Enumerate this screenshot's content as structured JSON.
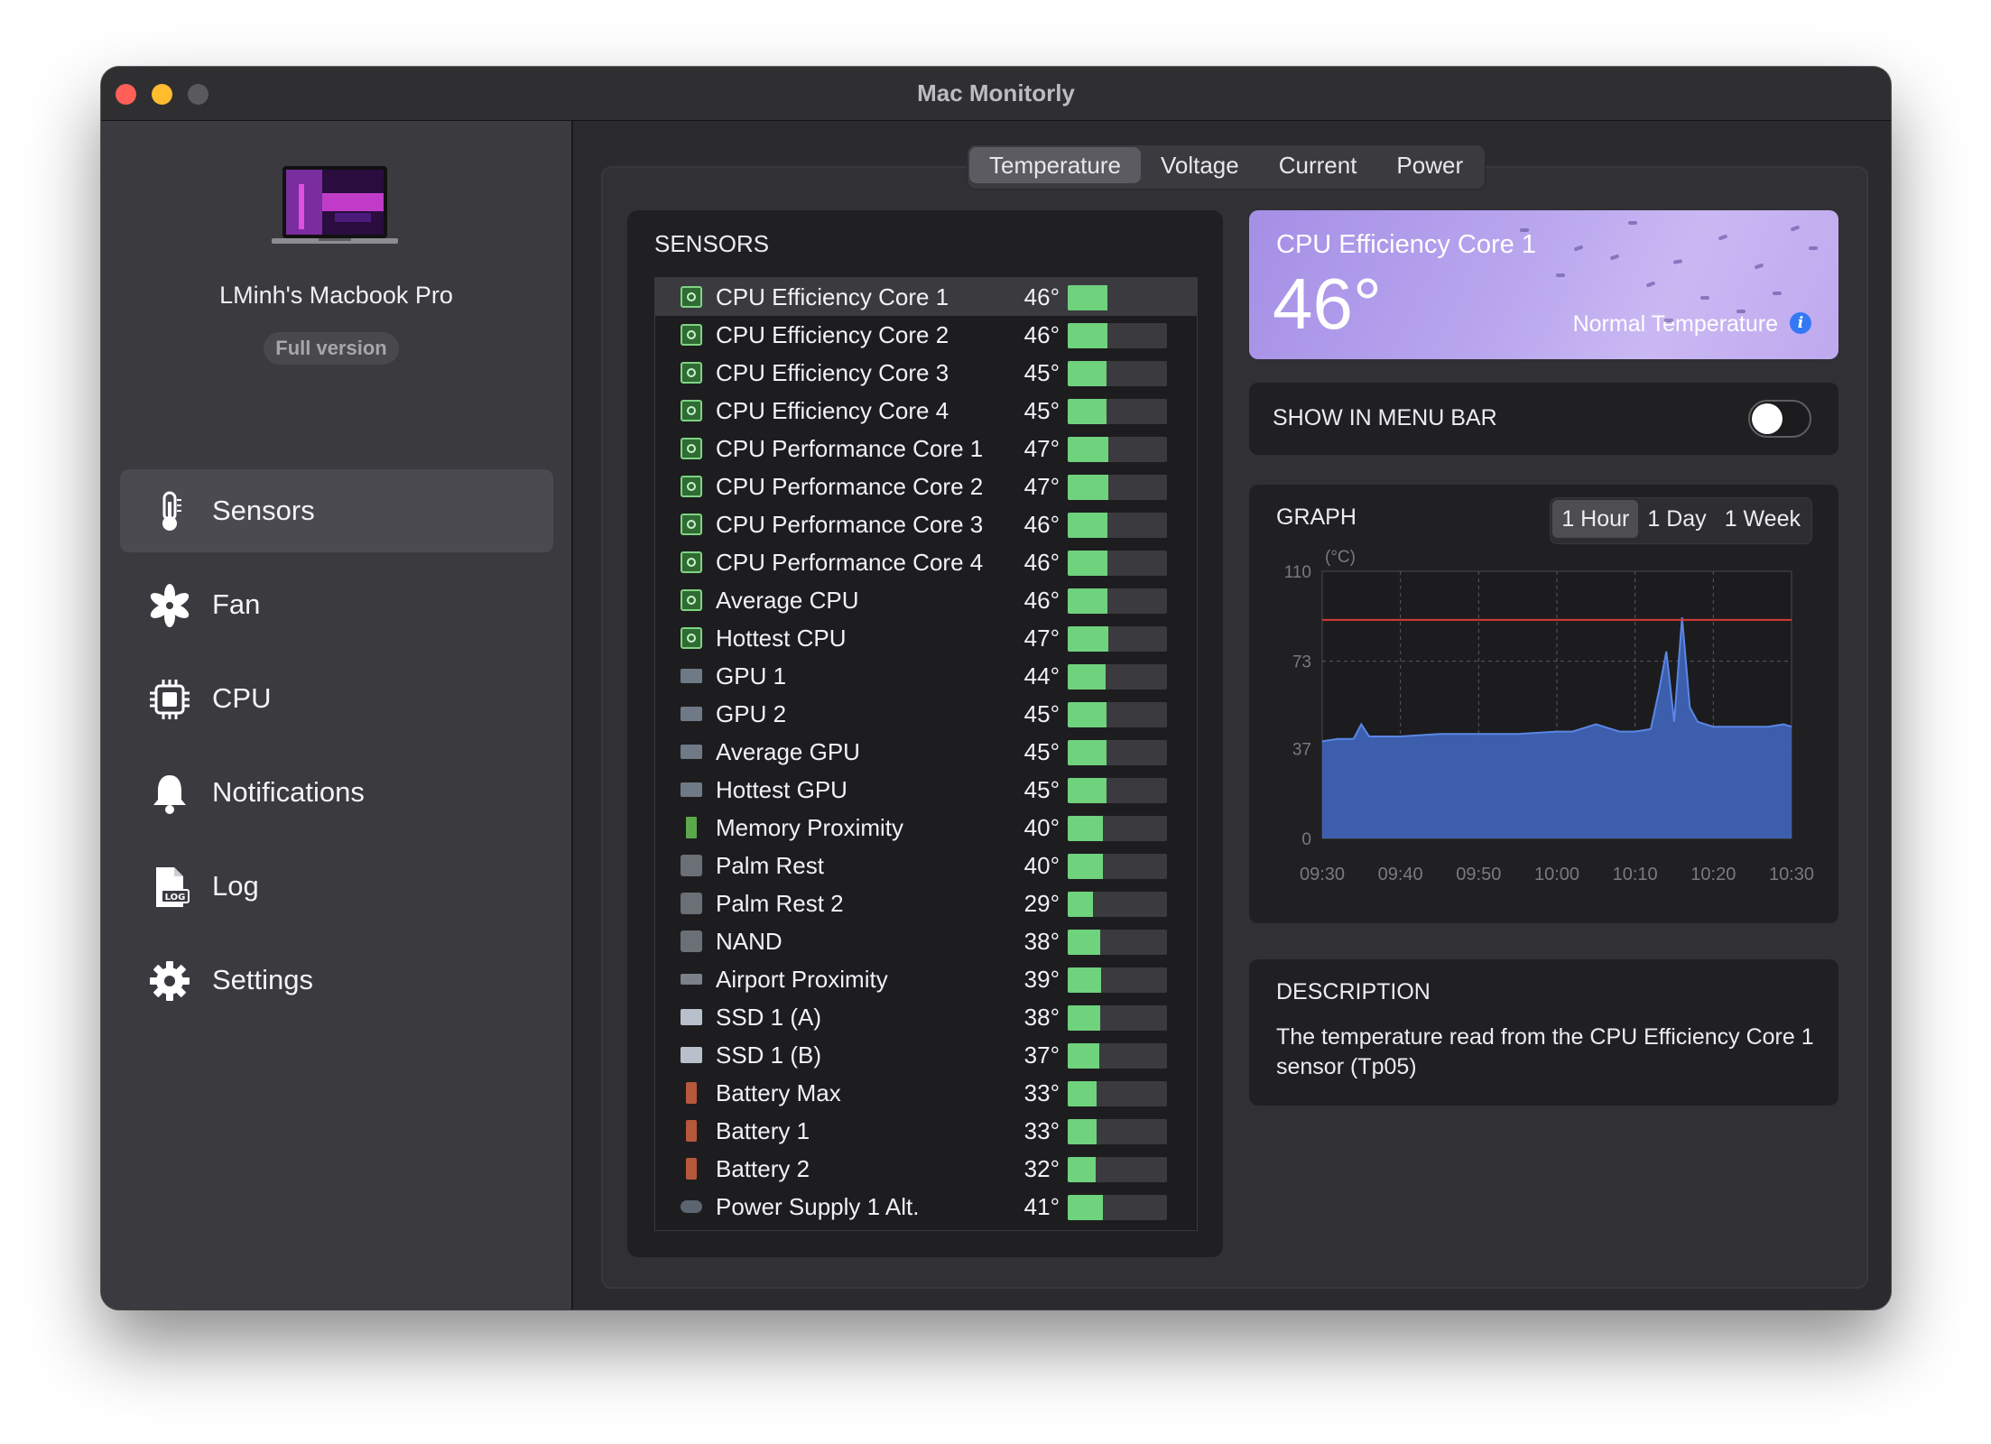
{
  "window": {
    "title": "Mac Monitorly"
  },
  "device": {
    "name": "LMinh's Macbook Pro",
    "version_badge": "Full version"
  },
  "sidebar": {
    "items": [
      {
        "label": "Sensors",
        "icon": "thermometer-icon",
        "active": true
      },
      {
        "label": "Fan",
        "icon": "fan-icon",
        "active": false
      },
      {
        "label": "CPU",
        "icon": "cpu-chip-icon",
        "active": false
      },
      {
        "label": "Notifications",
        "icon": "bell-icon",
        "active": false
      },
      {
        "label": "Log",
        "icon": "log-file-icon",
        "active": false
      },
      {
        "label": "Settings",
        "icon": "gear-icon",
        "active": false
      }
    ]
  },
  "tabs": [
    {
      "label": "Temperature",
      "active": true
    },
    {
      "label": "Voltage",
      "active": false
    },
    {
      "label": "Current",
      "active": false
    },
    {
      "label": "Power",
      "active": false
    }
  ],
  "sensors": {
    "title": "SENSORS",
    "rows": [
      {
        "name": "CPU Efficiency Core 1",
        "temp": "46°",
        "value": 46,
        "icon": "cpu"
      },
      {
        "name": "CPU Efficiency Core 2",
        "temp": "46°",
        "value": 46,
        "icon": "cpu"
      },
      {
        "name": "CPU Efficiency Core 3",
        "temp": "45°",
        "value": 45,
        "icon": "cpu"
      },
      {
        "name": "CPU Efficiency Core 4",
        "temp": "45°",
        "value": 45,
        "icon": "cpu"
      },
      {
        "name": "CPU Performance Core 1",
        "temp": "47°",
        "value": 47,
        "icon": "cpu"
      },
      {
        "name": "CPU Performance Core 2",
        "temp": "47°",
        "value": 47,
        "icon": "cpu"
      },
      {
        "name": "CPU Performance Core 3",
        "temp": "46°",
        "value": 46,
        "icon": "cpu"
      },
      {
        "name": "CPU Performance Core 4",
        "temp": "46°",
        "value": 46,
        "icon": "cpu"
      },
      {
        "name": "Average CPU",
        "temp": "46°",
        "value": 46,
        "icon": "cpu"
      },
      {
        "name": "Hottest CPU",
        "temp": "47°",
        "value": 47,
        "icon": "cpu"
      },
      {
        "name": "GPU 1",
        "temp": "44°",
        "value": 44,
        "icon": "gpu"
      },
      {
        "name": "GPU 2",
        "temp": "45°",
        "value": 45,
        "icon": "gpu"
      },
      {
        "name": "Average GPU",
        "temp": "45°",
        "value": 45,
        "icon": "gpu"
      },
      {
        "name": "Hottest GPU",
        "temp": "45°",
        "value": 45,
        "icon": "gpu"
      },
      {
        "name": "Memory Proximity",
        "temp": "40°",
        "value": 40,
        "icon": "mem"
      },
      {
        "name": "Palm Rest",
        "temp": "40°",
        "value": 40,
        "icon": "board"
      },
      {
        "name": "Palm Rest 2",
        "temp": "29°",
        "value": 29,
        "icon": "board"
      },
      {
        "name": "NAND",
        "temp": "38°",
        "value": 38,
        "icon": "board"
      },
      {
        "name": "Airport Proximity",
        "temp": "39°",
        "value": 39,
        "icon": "air"
      },
      {
        "name": "SSD 1 (A)",
        "temp": "38°",
        "value": 38,
        "icon": "ssd"
      },
      {
        "name": "SSD 1 (B)",
        "temp": "37°",
        "value": 37,
        "icon": "ssd"
      },
      {
        "name": "Battery Max",
        "temp": "33°",
        "value": 33,
        "icon": "batt"
      },
      {
        "name": "Battery 1",
        "temp": "33°",
        "value": 33,
        "icon": "batt"
      },
      {
        "name": "Battery 2",
        "temp": "32°",
        "value": 32,
        "icon": "batt"
      },
      {
        "name": "Power Supply 1 Alt.",
        "temp": "41°",
        "value": 41,
        "icon": "psu"
      }
    ]
  },
  "selected": {
    "name": "CPU Efficiency Core 1",
    "temp": "46°",
    "status": "Normal Temperature"
  },
  "menu_bar": {
    "label": "SHOW IN MENU BAR",
    "enabled": false
  },
  "graph": {
    "title": "GRAPH",
    "ranges": [
      {
        "label": "1 Hour",
        "active": true
      },
      {
        "label": "1 Day",
        "active": false
      },
      {
        "label": "1 Week",
        "active": false
      }
    ],
    "unit": "(°C)",
    "y_ticks": [
      "110",
      "73",
      "37",
      "0"
    ],
    "x_ticks": [
      "09:30",
      "09:40",
      "09:50",
      "10:00",
      "10:10",
      "10:20",
      "10:30"
    ],
    "threshold": 90,
    "colors": {
      "fill": "#3e62b4",
      "line": "#5b86e6",
      "threshold": "#d63a3a"
    }
  },
  "chart_data": {
    "type": "area",
    "title": "GRAPH",
    "xlabel": "",
    "ylabel": "(°C)",
    "ylim": [
      0,
      110
    ],
    "x": [
      "09:30",
      "09:32",
      "09:34",
      "09:35",
      "09:36",
      "09:38",
      "09:40",
      "09:45",
      "09:50",
      "09:55",
      "10:00",
      "10:02",
      "10:05",
      "10:08",
      "10:10",
      "10:12",
      "10:13",
      "10:14",
      "10:15",
      "10:16",
      "10:17",
      "10:18",
      "10:20",
      "10:22",
      "10:25",
      "10:27",
      "10:29",
      "10:30"
    ],
    "series": [
      {
        "values": [
          40,
          41,
          41,
          47,
          42,
          42,
          42,
          43,
          43,
          43,
          44,
          44,
          47,
          44,
          44,
          45,
          60,
          77,
          48,
          91,
          54,
          48,
          46,
          46,
          46,
          46,
          47,
          46
        ]
      }
    ],
    "threshold": 90,
    "grid": true
  },
  "description": {
    "title": "DESCRIPTION",
    "text": "The temperature read from the CPU Efficiency Core 1 sensor (Tp05)"
  }
}
